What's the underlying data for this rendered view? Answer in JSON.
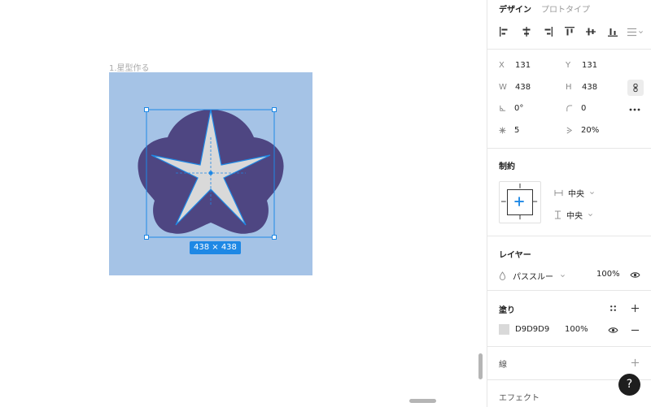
{
  "canvas": {
    "frame_label": "1.星型作る",
    "size_badge": "438 × 438"
  },
  "panel": {
    "tabs": [
      {
        "label": "デザイン",
        "active": true
      },
      {
        "label": "プロトタイプ",
        "active": false
      }
    ],
    "geometry": {
      "x_label": "X",
      "x_value": "131",
      "y_label": "Y",
      "y_value": "131",
      "w_label": "W",
      "w_value": "438",
      "h_label": "H",
      "h_value": "438",
      "rotation_value": "0°",
      "corner_value": "0",
      "points_value": "5",
      "ratio_value": "20%"
    },
    "constraints": {
      "title": "制約",
      "horizontal": "中央",
      "vertical": "中央"
    },
    "layer": {
      "title": "レイヤー",
      "blend_mode": "パススルー",
      "opacity": "100%"
    },
    "fill": {
      "title": "塗り",
      "color_hex": "D9D9D9",
      "swatch_color": "#D9D9D9",
      "opacity": "100%"
    },
    "stroke": {
      "title": "線"
    },
    "effect": {
      "title": "エフェクト"
    }
  },
  "help": {
    "label": "?"
  },
  "colors": {
    "frame_bg": "#a5c3e6",
    "flower": "#4e4682",
    "star": "#d9d9d9",
    "selection": "#1e88e5"
  }
}
